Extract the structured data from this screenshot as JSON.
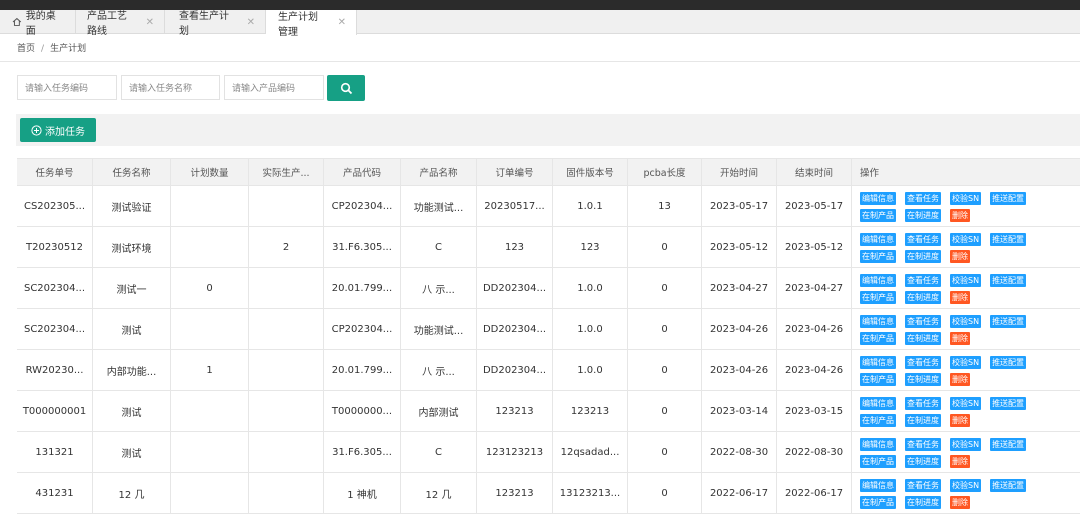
{
  "tabs": [
    {
      "label": "我的桌面",
      "icon": "home-icon",
      "closable": false,
      "active": false
    },
    {
      "label": "产品工艺路线",
      "closable": true,
      "active": false
    },
    {
      "label": "查看生产计划",
      "closable": true,
      "active": false
    },
    {
      "label": "生产计划管理",
      "closable": true,
      "active": true
    }
  ],
  "breadcrumb": {
    "home": "首页",
    "separator": "/",
    "current": "生产计划"
  },
  "search": {
    "task_code_placeholder": "请输入任务编码",
    "task_name_placeholder": "请输入任务名称",
    "product_code_placeholder": "请输入产品编码",
    "button_icon": "search-icon"
  },
  "toolbar": {
    "add_label": "添加任务",
    "add_icon": "plus-circle-icon"
  },
  "colors": {
    "primary": "#16a085",
    "info": "#1e9fff",
    "danger": "#ff5722"
  },
  "table": {
    "headers": [
      "任务单号",
      "任务名称",
      "计划数量",
      "实际生产...",
      "产品代码",
      "产品名称",
      "订单编号",
      "固件版本号",
      "pcba长度",
      "开始时间",
      "结束时间",
      "操作"
    ],
    "action_labels": {
      "edit": "编辑信息",
      "view": "查看任务",
      "verify_sn": "校验SN",
      "push_config": "推送配置",
      "in_product": "在制产品",
      "in_progress": "在制进度",
      "delete": "删除"
    },
    "rows": [
      {
        "task_no": "CS202305...",
        "task_name": "测试验证",
        "plan_qty": "",
        "actual_qty": "",
        "product_code": "CP202304...",
        "product_name": "功能测试...",
        "order_no": "20230517...",
        "firmware": "1.0.1",
        "pcba": "13",
        "start": "2023-05-17",
        "end": "2023-05-17"
      },
      {
        "task_no": "T20230512",
        "task_name": "测试环境",
        "plan_qty": "",
        "actual_qty": "2",
        "product_code": "31.F6.305...",
        "product_name": "C",
        "order_no": "123",
        "firmware": "123",
        "pcba": "0",
        "start": "2023-05-12",
        "end": "2023-05-12"
      },
      {
        "task_no": "SC202304...",
        "task_name": "测试一",
        "plan_qty": "0",
        "actual_qty": "",
        "product_code": "20.01.799...",
        "product_name": "八 示...",
        "order_no": "DD202304...",
        "firmware": "1.0.0",
        "pcba": "0",
        "start": "2023-04-27",
        "end": "2023-04-27"
      },
      {
        "task_no": "SC202304...",
        "task_name": "测试",
        "plan_qty": "",
        "actual_qty": "",
        "product_code": "CP202304...",
        "product_name": "功能测试...",
        "order_no": "DD202304...",
        "firmware": "1.0.0",
        "pcba": "0",
        "start": "2023-04-26",
        "end": "2023-04-26"
      },
      {
        "task_no": "RW20230...",
        "task_name": "内部功能...",
        "plan_qty": "1",
        "actual_qty": "",
        "product_code": "20.01.799...",
        "product_name": "八 示...",
        "order_no": "DD202304...",
        "firmware": "1.0.0",
        "pcba": "0",
        "start": "2023-04-26",
        "end": "2023-04-26"
      },
      {
        "task_no": "T000000001",
        "task_name": "测试",
        "plan_qty": "",
        "actual_qty": "",
        "product_code": "T0000000...",
        "product_name": "内部测试",
        "order_no": "123213",
        "firmware": "123213",
        "pcba": "0",
        "start": "2023-03-14",
        "end": "2023-03-15"
      },
      {
        "task_no": "131321",
        "task_name": "测试",
        "plan_qty": "",
        "actual_qty": "",
        "product_code": "31.F6.305...",
        "product_name": "C",
        "order_no": "123123213",
        "firmware": "12qsadad...",
        "pcba": "0",
        "start": "2022-08-30",
        "end": "2022-08-30"
      },
      {
        "task_no": "431231",
        "task_name": "12 几",
        "plan_qty": "",
        "actual_qty": "",
        "product_code": "1 神机",
        "product_name": "12 几",
        "order_no": "123213",
        "firmware": "13123213...",
        "pcba": "0",
        "start": "2022-06-17",
        "end": "2022-06-17"
      }
    ]
  }
}
